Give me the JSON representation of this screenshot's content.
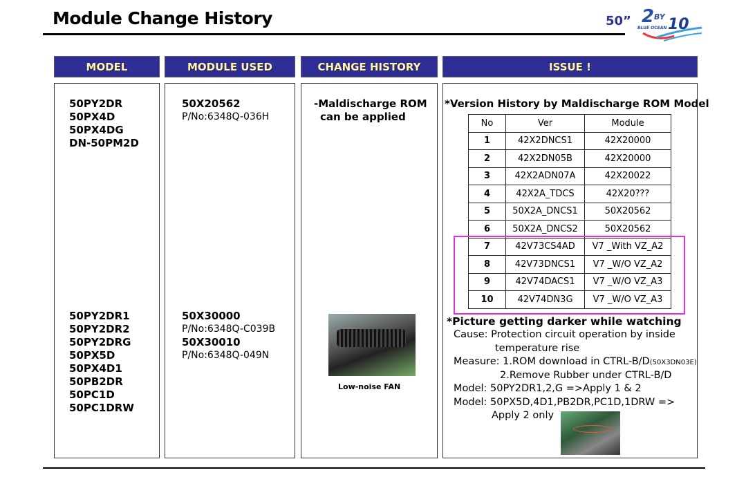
{
  "title": "Module Change History",
  "logo": {
    "size": "50”",
    "text": "2BY10 BLUE OCEAN"
  },
  "headers": [
    "MODEL",
    "MODULE USED",
    "CHANGE HISTORY",
    "ISSUE !"
  ],
  "group1": {
    "models": [
      "50PY2DR",
      "50PX4D",
      "50PX4DG",
      "DN-50PM2D"
    ],
    "module": "50X20562",
    "pn": "P/No:6348Q-036H",
    "change": [
      "-Maldischarge ROM",
      "can be applied"
    ]
  },
  "group2": {
    "models": [
      "50PY2DR1",
      "50PY2DR2",
      "50PY2DRG",
      "50PX5D",
      "50PX4D1",
      "50PB2DR",
      "50PC1D",
      "50PC1DRW"
    ],
    "modules": [
      {
        "name": "50X30000",
        "pn": "P/No:6348Q-C039B"
      },
      {
        "name": "50X30010",
        "pn": "P/No:6348Q-049N"
      }
    ],
    "fan_caption": "Low-noise FAN"
  },
  "issue": {
    "heading": "*Version History by Maldischarge ROM Model",
    "table_headers": [
      "No",
      "Ver",
      "Module"
    ],
    "rows": [
      [
        "1",
        "42X2DNCS1",
        "42X20000"
      ],
      [
        "2",
        "42X2DN05B",
        "42X20000"
      ],
      [
        "3",
        "42X2ADN07A",
        "42X20022"
      ],
      [
        "4",
        "42X2A_TDCS",
        "42X20???"
      ],
      [
        "5",
        "50X2A_DNCS1",
        "50X20562"
      ],
      [
        "6",
        "50X2A_DNCS2",
        "50X20562"
      ],
      [
        "7",
        "42V73CS4AD",
        "V7 _With VZ_A2"
      ],
      [
        "8",
        "42V73DNCS1",
        "V7 _W/O VZ_A2"
      ],
      [
        "9",
        "42V74DACS1",
        "V7 _W/O VZ_A3"
      ],
      [
        "10",
        "42V74DN3G",
        "V7 _W/O VZ_A3"
      ]
    ],
    "picture_heading": "*Picture getting darker while watching",
    "cause1": "Cause: Protection circuit operation by inside",
    "cause2": "temperature rise",
    "measure1": "Measure: 1.ROM download in CTRL-B/D",
    "measure1_small": "(50X3DN03E)",
    "measure2": "2.Remove Rubber under CTRL-B/D",
    "model1": "Model: 50PY2DR1,2,G =>Apply 1 & 2",
    "model2": "Model: 50PX5D,4D1,PB2DR,PC1D,1DRW =>",
    "model2b": "Apply 2 only"
  }
}
